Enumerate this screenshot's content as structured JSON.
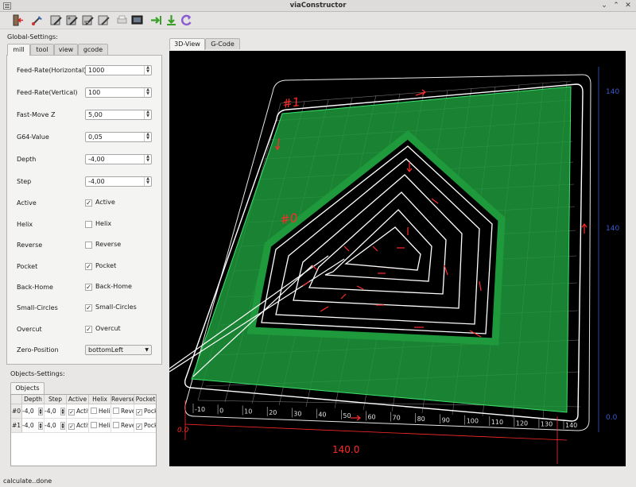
{
  "window": {
    "title": "viaConstructor"
  },
  "toolbar": {
    "icons": [
      "exit-icon",
      "load-icon",
      "save-icon",
      "save-as-icon",
      "save-setup-icon",
      "load-setup-icon",
      "print-icon",
      "monitor-icon",
      "export-icon",
      "download-icon",
      "reload-icon"
    ]
  },
  "global_settings": {
    "label": "Global-Settings:",
    "tabs": [
      "mill",
      "tool",
      "view",
      "gcode"
    ],
    "active_tab": "mill",
    "fields": {
      "feed_h": {
        "label": "Feed-Rate(Horizontal)",
        "value": "1000"
      },
      "feed_v": {
        "label": "Feed-Rate(Vertical)",
        "value": "100"
      },
      "fast_z": {
        "label": "Fast-Move Z",
        "value": "5,00"
      },
      "g64": {
        "label": "G64-Value",
        "value": "0,05"
      },
      "depth": {
        "label": "Depth",
        "value": "-4,00"
      },
      "step": {
        "label": "Step",
        "value": "-4,00"
      }
    },
    "checks": {
      "active": {
        "label": "Active",
        "text": "Active",
        "checked": "✓"
      },
      "helix": {
        "label": "Helix",
        "text": "Helix",
        "checked": ""
      },
      "reverse": {
        "label": "Reverse",
        "text": "Reverse",
        "checked": ""
      },
      "pocket": {
        "label": "Pocket",
        "text": "Pocket",
        "checked": "✓"
      },
      "back_home": {
        "label": "Back-Home",
        "text": "Back-Home",
        "checked": "✓"
      },
      "small_circles": {
        "label": "Small-Circles",
        "text": "Small-Circles",
        "checked": "✓"
      },
      "overcut": {
        "label": "Overcut",
        "text": "Overcut",
        "checked": "✓"
      }
    },
    "zero_position": {
      "label": "Zero-Position",
      "value": "bottomLeft"
    }
  },
  "objects_settings": {
    "label": "Objects-Settings:",
    "tab": "Objects",
    "columns": [
      "Depth",
      "Step",
      "Active",
      "Helix",
      "Reverse",
      "Pocket"
    ],
    "rows": [
      {
        "id": "#0",
        "depth": "-4,0",
        "step": "-4,0",
        "active": "Activ",
        "active_chk": "✓",
        "helix": "Heli",
        "helix_chk": "",
        "reverse": "Reve",
        "reverse_chk": "",
        "pocket": "Pock",
        "pocket_chk": "✓"
      },
      {
        "id": "#1",
        "depth": "-4,0",
        "step": "-4,0",
        "active": "Activ",
        "active_chk": "✓",
        "helix": "Heli",
        "helix_chk": "",
        "reverse": "Reve",
        "reverse_chk": "",
        "pocket": "Pock",
        "pocket_chk": "✓"
      }
    ]
  },
  "view_tabs": [
    "3D-View",
    "G-Code"
  ],
  "active_view": "3D-View",
  "scene": {
    "object_labels": [
      "#1",
      "#0"
    ],
    "dimension_label": "140.0",
    "side_labels": [
      "140",
      "140",
      "0.0"
    ],
    "bottom_zero": "0.0",
    "ruler_ticks": [
      "-10",
      "0",
      "10",
      "20",
      "30",
      "40",
      "50",
      "60",
      "70",
      "80",
      "90",
      "100",
      "110",
      "120",
      "130",
      "140"
    ],
    "colors": {
      "background": "#000000",
      "pocket_fill": "#1e9a3c",
      "toolpath": "#ffffff",
      "direction_marks": "#ff2020",
      "grid": "#8a8a8a"
    }
  },
  "status": {
    "text": "calculate..done"
  }
}
